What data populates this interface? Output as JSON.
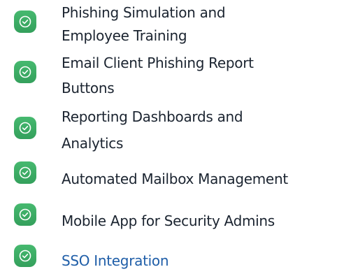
{
  "features": [
    {
      "lines": [
        "Phishing Simulation and",
        "Employee Training"
      ],
      "is_link": false
    },
    {
      "lines": [
        "Email Client Phishing Report",
        "Buttons"
      ],
      "is_link": false
    },
    {
      "lines": [
        "Reporting Dashboards and",
        "Analytics"
      ],
      "is_link": false
    },
    {
      "lines": [
        "Automated Mailbox Management"
      ],
      "is_link": false
    },
    {
      "lines": [
        "Mobile App for Security Admins"
      ],
      "is_link": false
    },
    {
      "lines": [
        "SSO Integration"
      ],
      "is_link": true
    }
  ],
  "icon": "check-circle-icon",
  "colors": {
    "badge": "#3eaf67",
    "text": "#1b2430",
    "link": "#1f5ea8"
  }
}
